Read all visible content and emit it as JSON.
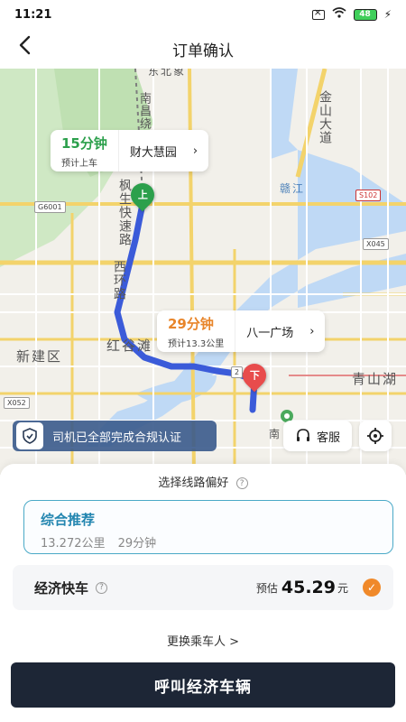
{
  "status_bar": {
    "time": "11:21",
    "battery": "48"
  },
  "header": {
    "title": "订单确认"
  },
  "map": {
    "labels": {
      "district_xinjian": "新建区",
      "district_hongguchan": "红谷滩",
      "district_qingshanhu": "青山湖",
      "road_fengsheng": "枫生快速路",
      "road_xihuan": "西环路",
      "road_jinshan": "金山大道",
      "road_nanchang": "南昌绕",
      "river_ganjiang": "赣江",
      "top_fragment": "东北象",
      "south_fragment": "南"
    },
    "road_tags": [
      "G6001",
      "S102",
      "X045",
      "X052",
      "2"
    ],
    "pickup": {
      "eta": "15分钟",
      "note": "预计上车",
      "place": "财大慧园",
      "pin": "上"
    },
    "trip": {
      "eta": "29分钟",
      "note": "预计13.3公里",
      "place": "八一广场",
      "pin": "下"
    },
    "compliance_text": "司机已全部完成合规认证",
    "service_label": "客服"
  },
  "sheet": {
    "preference_title": "选择线路偏好",
    "route": {
      "name": "综合推荐",
      "distance": "13.272公里",
      "duration": "29分钟"
    },
    "car": {
      "name": "经济快车",
      "estimate_label": "预估",
      "price": "45.29",
      "unit": "元"
    },
    "change_passenger": "更换乘车人 >",
    "cta": "呼叫经济车辆"
  },
  "colors": {
    "route": "#3b5bd9",
    "accent_green": "#2ca04c",
    "accent_orange": "#e8852a",
    "cta": "#1d2636",
    "selected_border": "#4aa9c7"
  }
}
